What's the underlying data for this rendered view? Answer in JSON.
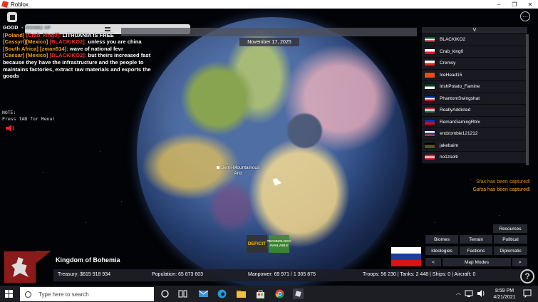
{
  "window": {
    "title": "Roblox",
    "controls": [
      "–",
      "❐",
      "✕"
    ]
  },
  "chat": {
    "good": "GOOD",
    "xp": "+ 0000852 XP",
    "messages": [
      {
        "tag": "[Poland]",
        "name": "[Crab_king0]:",
        "text": "LITHUANIA IS FREE",
        "name_color": "red"
      },
      {
        "tag": "[Cassyrl]",
        "mid": "[Mexico]",
        "name": "[BLACKIKO2]:",
        "text": "unless you are china",
        "name_color": "red"
      },
      {
        "tag": "[South Africa]",
        "name": "[zman514]:",
        "text": "wave of national fevr",
        "name_color": "orange"
      },
      {
        "tag": "[Caesar]",
        "mid": "[Mexico]",
        "name": "[BLACKIKO2]:",
        "text": "but theirs increased fast because they have the infrastructure and the people to maintains factories, extract raw materials and exports the goods",
        "name_color": "red"
      }
    ]
  },
  "note": {
    "line1": "NOTE:",
    "line2": "Press TAB for Menu!"
  },
  "date": "November 17, 2025",
  "player_list": {
    "header": "V",
    "players": [
      {
        "name": "BLACKIKO2",
        "flag": [
          "#006847",
          "#ffffff",
          "#ce1126"
        ]
      },
      {
        "name": "Crab_king0",
        "flag": [
          "#ffffff",
          "#dc143c"
        ]
      },
      {
        "name": "Cremsy",
        "flag": [
          "#ffffff",
          "#d52b1e"
        ]
      },
      {
        "name": "IceHead15",
        "flag": [
          "#e05020",
          "#e05020"
        ]
      },
      {
        "name": "IrishPotato_Famine",
        "flag": [
          "#01411c",
          "#ffffff"
        ]
      },
      {
        "name": "PhantomSwingshat",
        "flag": [
          "#002a8f",
          "#ffffff",
          "#cf142b"
        ]
      },
      {
        "name": "ReallyAddicted",
        "flag": [
          "#cd2a3e",
          "#ffffff",
          "#436f4d"
        ]
      },
      {
        "name": "RemanGamingRblx",
        "flag": [
          "#0038a8",
          "#ce1126"
        ]
      },
      {
        "name": "endzombie121212",
        "flag": [
          "#ffffff",
          "#0039a6",
          "#d52b1e"
        ]
      },
      {
        "name": "jakebairn",
        "flag": [
          "#000000",
          "#d32011",
          "#007a36"
        ]
      },
      {
        "name": "no1zsolti",
        "flag": [
          "#ce2939",
          "#ffffff",
          "#ce2939"
        ]
      }
    ]
  },
  "notifications": {
    "cap1": "Sfax has been captured!",
    "cap2": "Gafsa has been captured!"
  },
  "map_label": {
    "line1": "Semi-Mountainous",
    "line2": "Arid"
  },
  "deficit": "DEFICIT",
  "tech": "TECHNOLOGY AVAILABLE",
  "country": {
    "name": "Kingdom of Bohemia",
    "flag": [
      "#ffffff",
      "#1b3fa0",
      "#d7141a"
    ]
  },
  "stats": {
    "treasury": "Treasury:  $615 918 934",
    "population": "Population: 65 873 603",
    "manpower": "Manpower:  69 971  /  1 305 875",
    "military": "Troops: 56 230  |  Tanks: 2 448  |  Ships: 0  |  Aircraft: 0"
  },
  "buttons": {
    "resources": "Resources",
    "biomes": "Biomes",
    "terrain": "Terrain",
    "political": "Political",
    "ideologies": "Ideologies",
    "factions": "Factions",
    "diplomatic": "Diplomatic",
    "prev": "<",
    "map_modes": "Map Modes",
    "next": ">"
  },
  "help": "?",
  "menu": "⋯",
  "taskbar": {
    "search_placeholder": "Type here to search",
    "time": "8:59 PM",
    "date": "4/21/2021"
  }
}
